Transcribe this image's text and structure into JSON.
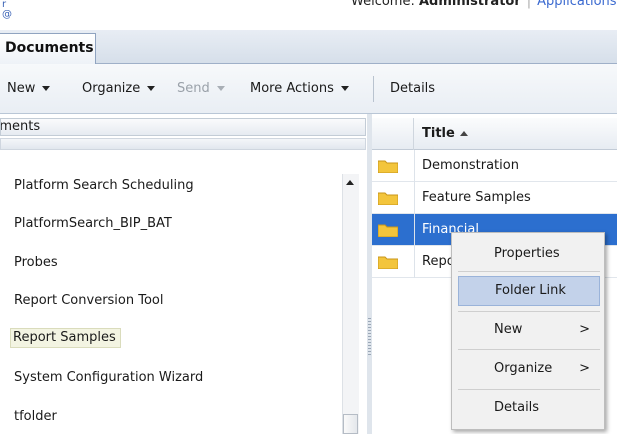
{
  "header": {
    "welcome_text": "Welcome: ",
    "user_name": "Administrator",
    "app_link": "Applications",
    "link_a": "r",
    "link_b": "@"
  },
  "tabs": [
    {
      "label": "Documents"
    }
  ],
  "toolbar": {
    "new_label": "New",
    "organize_label": "Organize",
    "send_label": "Send",
    "more_actions_label": "More Actions",
    "details_label": "Details"
  },
  "left_panel": {
    "header_label": "Documents",
    "items": [
      {
        "label": "Platform Search Scheduling"
      },
      {
        "label": "PlatformSearch_BIP_BAT"
      },
      {
        "label": "Probes"
      },
      {
        "label": "Report Conversion Tool"
      },
      {
        "label": "Report Samples",
        "selected": true
      },
      {
        "label": "System Configuration Wizard"
      },
      {
        "label": "tfolder"
      }
    ]
  },
  "list": {
    "column_title": "Title",
    "rows": [
      {
        "title": "Demonstration",
        "icon": "folder-icon"
      },
      {
        "title": "Feature Samples",
        "icon": "folder-icon"
      },
      {
        "title": "Financial",
        "icon": "folder-icon",
        "selected": true
      },
      {
        "title": "Report Samples",
        "icon": "folder-icon"
      }
    ]
  },
  "context_menu": {
    "items": [
      {
        "label": "Properties"
      },
      {
        "label": "Folder Link",
        "highlighted": true
      },
      {
        "label": "New",
        "submenu": true
      },
      {
        "label": "Organize",
        "submenu": true
      },
      {
        "label": "Details"
      }
    ],
    "submenu_arrow": ">"
  },
  "colors": {
    "selection_blue": "#2c6fcf",
    "menu_highlight": "#c3d2ea",
    "folder_yellow": "#f3c53c"
  }
}
